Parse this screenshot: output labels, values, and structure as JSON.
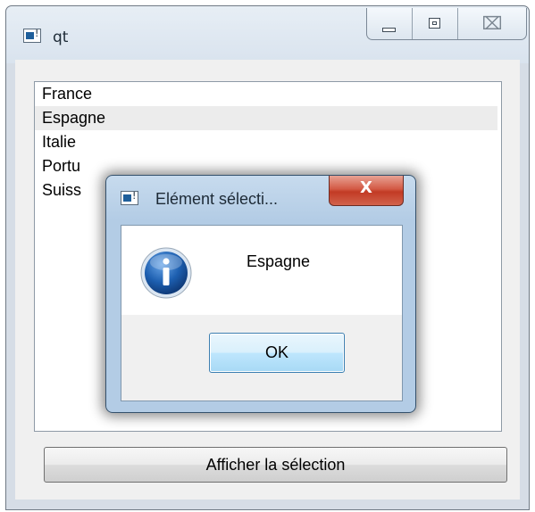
{
  "window": {
    "title": "qt",
    "caption_buttons": {
      "minimize_icon": "minimize-icon",
      "maximize_icon": "maximize-icon",
      "close_glyph": "⌧"
    }
  },
  "list": {
    "items": [
      {
        "label": "France"
      },
      {
        "label": "Espagne"
      },
      {
        "label": "Italie"
      },
      {
        "label": "Portu"
      },
      {
        "label": "Suiss"
      }
    ],
    "selected_index": 1,
    "selected_background": "#ececec"
  },
  "show_button": {
    "label": "Afficher la sélection"
  },
  "dialog": {
    "title": "Elément sélecti...",
    "close_glyph": "X",
    "icon": "information-icon",
    "message": "Espagne",
    "ok_label": "OK"
  },
  "colors": {
    "dialog_frame": "#b3cce5",
    "close_button": "#c23a24",
    "info_blue": "#1d5fb0"
  }
}
